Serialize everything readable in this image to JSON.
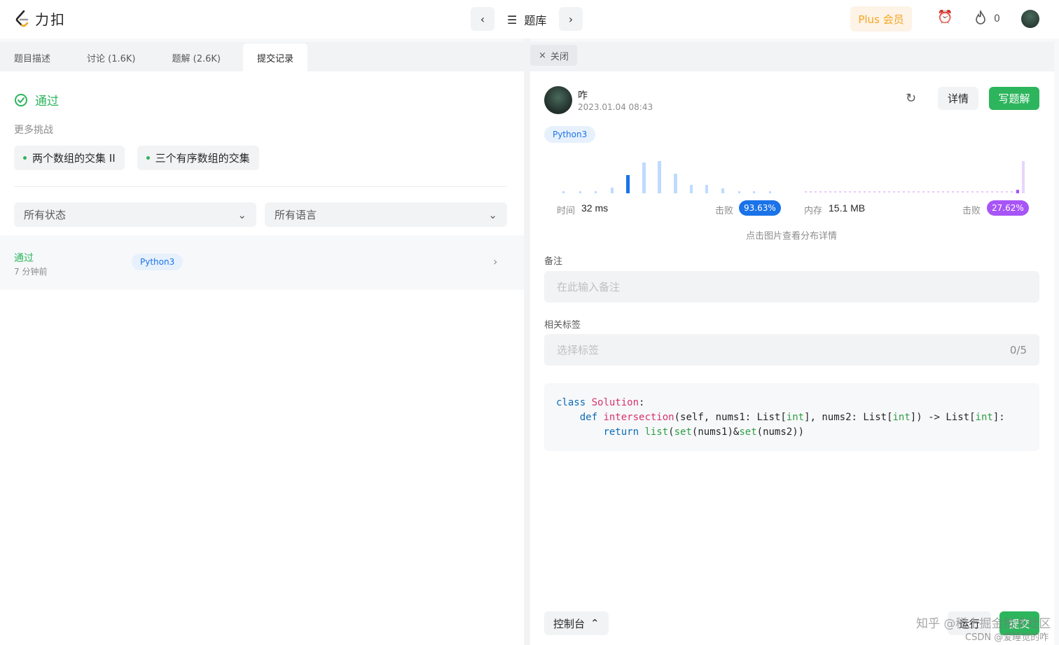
{
  "header": {
    "logo_text": "力扣",
    "problem_list_label": "题库",
    "plus_label": "Plus 会员",
    "streak_count": "0"
  },
  "left": {
    "tabs": [
      {
        "label": "题目描述"
      },
      {
        "label": "讨论 (1.6K)"
      },
      {
        "label": "题解 (2.6K)"
      },
      {
        "label": "提交记录"
      }
    ],
    "status": "通过",
    "more_challenges": "更多挑战",
    "challenges": [
      "两个数组的交集 II",
      "三个有序数组的交集"
    ],
    "filter_status": "所有状态",
    "filter_language": "所有语言",
    "submission": {
      "status": "通过",
      "time": "7 分钟前",
      "language": "Python3"
    }
  },
  "right": {
    "close_label": "关闭",
    "user_name": "咋",
    "submitted_at": "2023.01.04 08:43",
    "detail_label": "详情",
    "write_solution_label": "写题解",
    "language": "Python3",
    "runtime_label": "时间",
    "runtime_value": "32 ms",
    "runtime_beat_label": "击败",
    "runtime_beat": "93.63%",
    "memory_label": "内存",
    "memory_value": "15.1 MB",
    "memory_beat_label": "击败",
    "memory_beat": "27.62%",
    "chart_hint": "点击图片查看分布详情",
    "notes_label": "备注",
    "notes_placeholder": "在此输入备注",
    "tags_label": "相关标签",
    "tags_placeholder": "选择标签",
    "tags_count": "0/5",
    "code_lines": [
      "class Solution:",
      "    def intersection(self, nums1: List[int], nums2: List[int]) -> List[int]:",
      "        return list(set(nums1)&set(nums2))"
    ],
    "console_label": "控制台",
    "run_label": "运行",
    "submit_label": "提交"
  },
  "watermark": {
    "line1": "知乎 @稀土掘金技术社区",
    "line2": "CSDN @爱睡觉的咋"
  },
  "colors": {
    "accent_green": "#2db55d",
    "runtime_blue": "#1a73e8",
    "memory_purple": "#a855f7",
    "plus_orange": "#f5a623"
  }
}
